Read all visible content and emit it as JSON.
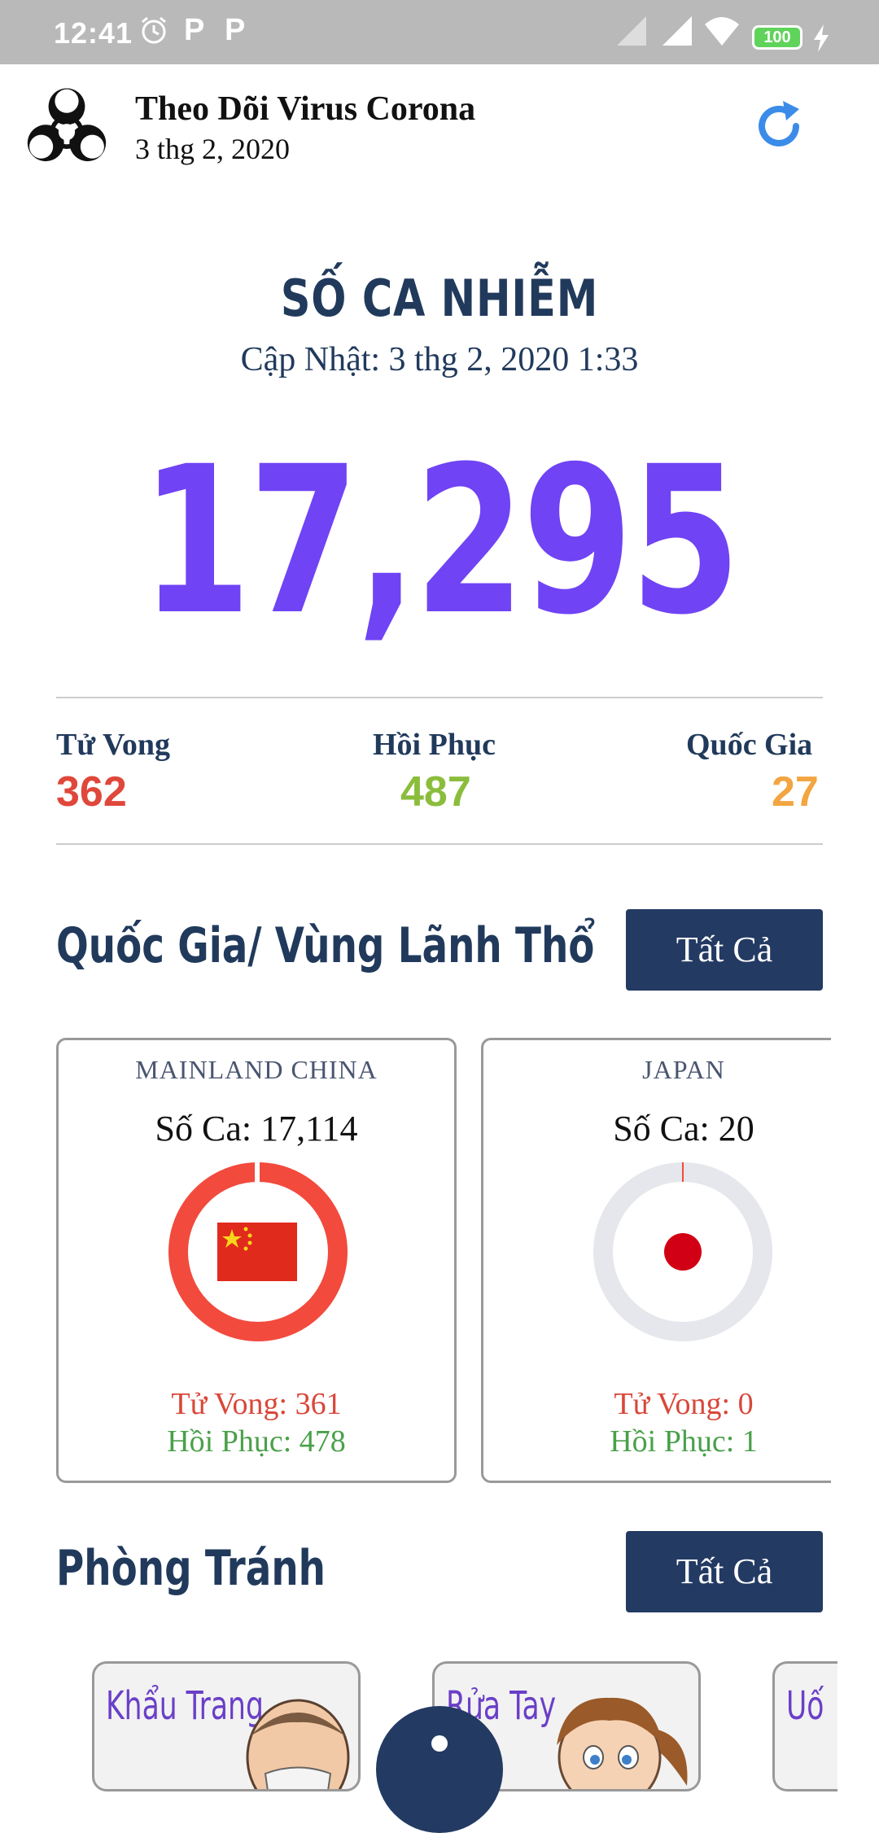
{
  "status_bar": {
    "time": "12:41",
    "battery": "100"
  },
  "header": {
    "title": "Theo Dõi Virus Corona",
    "date": "3 thg 2, 2020"
  },
  "summary": {
    "title": "SỐ CA NHIỄM",
    "updated": "Cập Nhật: 3 thg 2, 2020 1:33",
    "total": "17,295"
  },
  "stats": [
    {
      "label": "Tử Vong",
      "value": "362",
      "color": "#e0473b"
    },
    {
      "label": "Hồi Phục",
      "value": "487",
      "color": "#8bbd3c"
    },
    {
      "label": "Quốc Gia",
      "value": "27",
      "color": "#f2a541"
    }
  ],
  "countries_section": {
    "title": "Quốc Gia/ Vùng Lãnh Thổ",
    "button": "Tất Cả"
  },
  "country_cards": [
    {
      "name": "MAINLAND CHINA",
      "cases": "Số Ca: 17,114",
      "deaths": "Tử Vong: 361",
      "recovered": "Hồi Phục: 478",
      "ring_color": "#f24a3d",
      "share": 0.99
    },
    {
      "name": "JAPAN",
      "cases": "Số Ca: 20",
      "deaths": "Tử Vong: 0",
      "recovered": "Hồi Phục: 1",
      "ring_color": "#e5e7ec",
      "share": 0.001
    }
  ],
  "prevention_section": {
    "title": "Phòng Tránh",
    "button": "Tất Cả",
    "items": [
      {
        "label": "Khẩu Trang"
      },
      {
        "label": "Rửa Tay"
      },
      {
        "label": "Uố"
      }
    ]
  },
  "colors": {
    "accent": "#7043f5",
    "navy": "#233a63",
    "refresh": "#3b8ce8"
  }
}
